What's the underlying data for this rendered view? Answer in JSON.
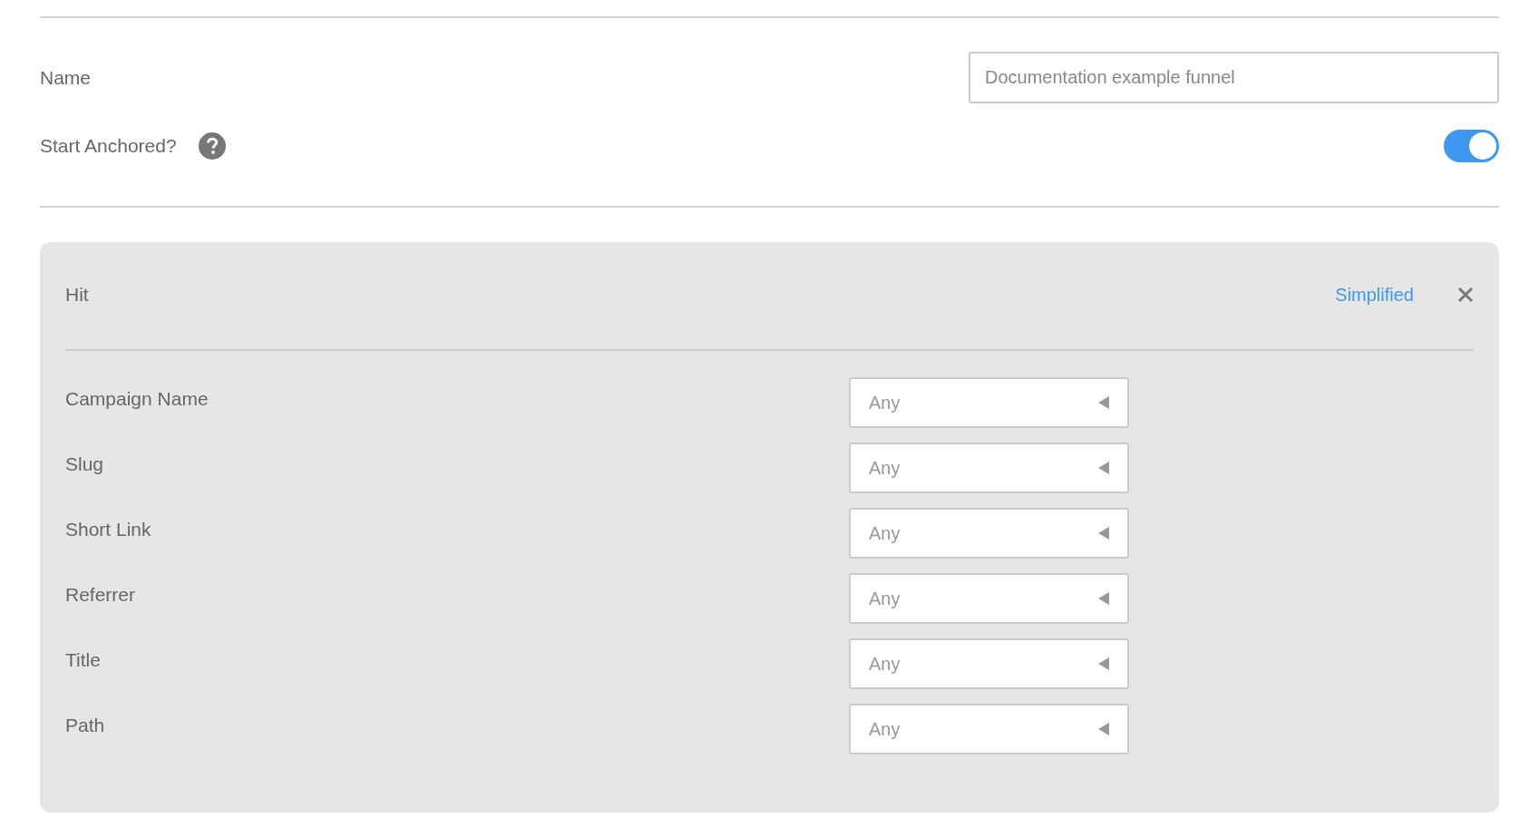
{
  "name_field": {
    "label": "Name",
    "value": "Documentation example funnel"
  },
  "start_anchored": {
    "label": "Start Anchored?",
    "on": true
  },
  "step": {
    "title": "Hit",
    "mode_link": "Simplified",
    "filters": [
      {
        "label": "Campaign Name",
        "value": "Any"
      },
      {
        "label": "Slug",
        "value": "Any"
      },
      {
        "label": "Short Link",
        "value": "Any"
      },
      {
        "label": "Referrer",
        "value": "Any"
      },
      {
        "label": "Title",
        "value": "Any"
      },
      {
        "label": "Path",
        "value": "Any"
      }
    ]
  }
}
